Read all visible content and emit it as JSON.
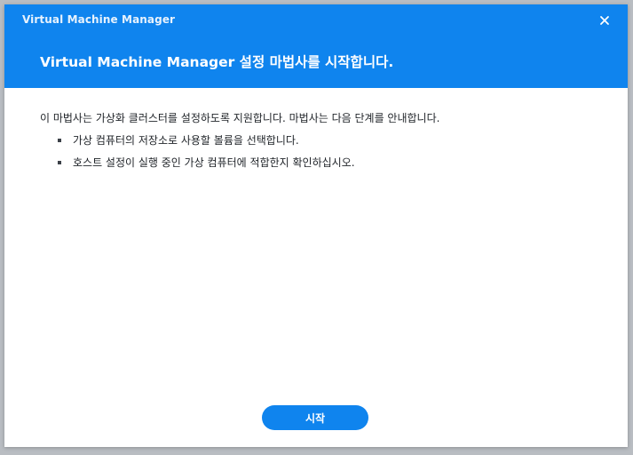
{
  "window": {
    "title": "Virtual Machine Manager",
    "close_icon": "close-icon"
  },
  "wizard": {
    "heading": "Virtual Machine Manager 설정 마법사를 시작합니다.",
    "intro": "이 마법사는 가상화 클러스터를 설정하도록 지원합니다. 마법사는 다음 단계를 안내합니다.",
    "steps": [
      {
        "label": "가상 컴퓨터의 저장소로 사용할 볼륨을 선택합니다."
      },
      {
        "label": "호스트 설정이 실행 중인 가상 컴퓨터에 적합한지 확인하십시오."
      }
    ]
  },
  "footer": {
    "start_label": "시작"
  },
  "colors": {
    "accent": "#0f84ee",
    "background": "#ffffff",
    "text": "#1f2328"
  }
}
